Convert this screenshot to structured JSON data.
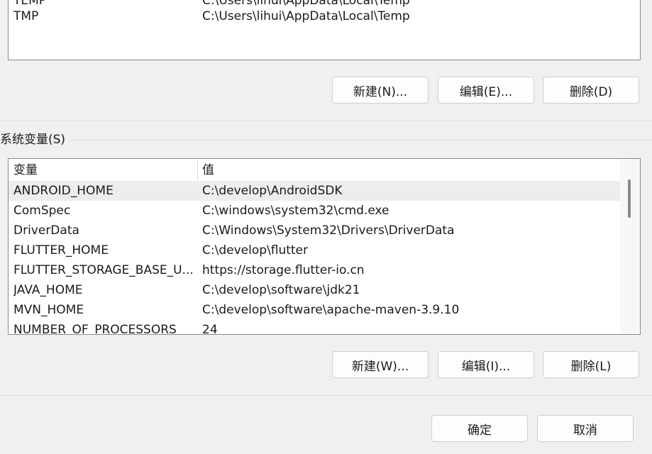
{
  "user_vars": {
    "rows": [
      {
        "name": "TEMP",
        "value": "C:\\Users\\lihui\\AppData\\Local\\Temp"
      },
      {
        "name": "TMP",
        "value": "C:\\Users\\lihui\\AppData\\Local\\Temp"
      }
    ],
    "buttons": {
      "new": "新建(N)...",
      "edit": "编辑(E)...",
      "delete": "删除(D)"
    }
  },
  "system_vars": {
    "label": "系统变量(S)",
    "headers": {
      "name": "变量",
      "value": "值"
    },
    "rows": [
      {
        "name": "ANDROID_HOME",
        "value": "C:\\develop\\AndroidSDK"
      },
      {
        "name": "ComSpec",
        "value": "C:\\windows\\system32\\cmd.exe"
      },
      {
        "name": "DriverData",
        "value": "C:\\Windows\\System32\\Drivers\\DriverData"
      },
      {
        "name": "FLUTTER_HOME",
        "value": "C:\\develop\\flutter"
      },
      {
        "name": "FLUTTER_STORAGE_BASE_U...",
        "value": "https://storage.flutter-io.cn"
      },
      {
        "name": "JAVA_HOME",
        "value": "C:\\develop\\software\\jdk21"
      },
      {
        "name": "MVN_HOME",
        "value": "C:\\develop\\software\\apache-maven-3.9.10"
      },
      {
        "name": "NUMBER_OF_PROCESSORS",
        "value": "24"
      }
    ],
    "buttons": {
      "new": "新建(W)...",
      "edit": "编辑(I)...",
      "delete": "删除(L)"
    }
  },
  "dialog_buttons": {
    "ok": "确定",
    "cancel": "取消"
  }
}
